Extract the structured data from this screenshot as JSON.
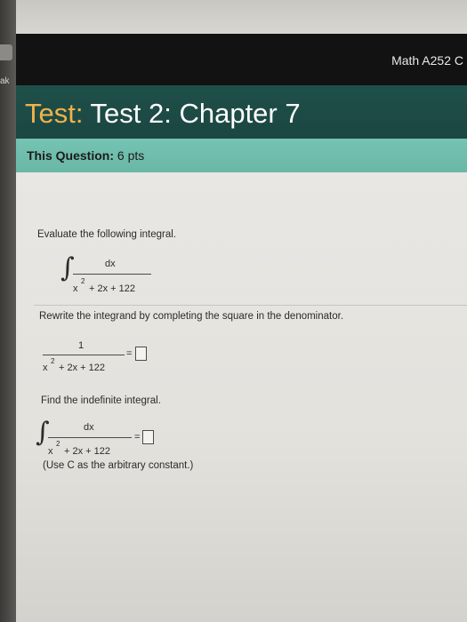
{
  "header": {
    "course_title": "Math A252 C"
  },
  "test": {
    "label": "Test:",
    "name": "Test 2: Chapter 7"
  },
  "question": {
    "points_label": "This Question:",
    "points_value": "6 pts"
  },
  "problem": {
    "instruction": "Evaluate the following integral.",
    "integral_numerator": "dx",
    "denominator_x": "x",
    "denominator_exp": "2",
    "denominator_rest": "+ 2x + 122",
    "step1_instruction": "Rewrite the integrand by completing the square in the denominator.",
    "step1_numerator": "1",
    "equals": "=",
    "step2_instruction": "Find the indefinite integral.",
    "note": "(Use C as the arbitrary constant.)"
  },
  "sidebar": {
    "mark": "ak"
  }
}
